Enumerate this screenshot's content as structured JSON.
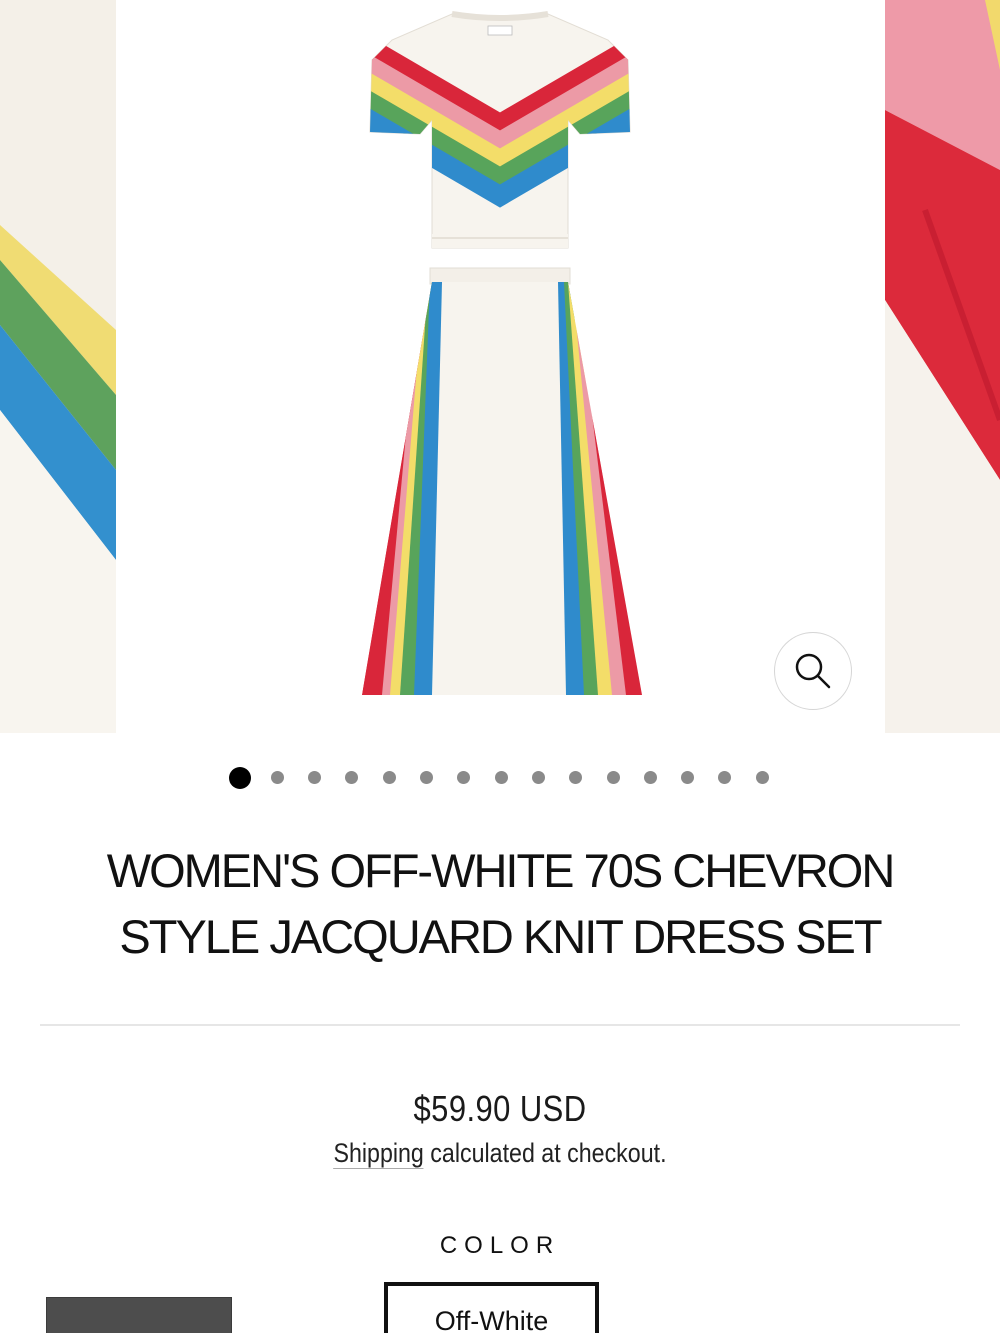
{
  "gallery": {
    "slide_count": 15,
    "active_index": 0,
    "zoom_icon": "search-icon",
    "product_colors": {
      "red": "#d9263a",
      "pink": "#ec9aa6",
      "yellow": "#f3dd69",
      "green": "#58a45b",
      "blue": "#2f8bcc",
      "fabric": "#f7f4ee"
    }
  },
  "product": {
    "title": "WOMEN'S OFF-WHITE 70S CHEVRON STYLE JACQUARD KNIT DRESS SET",
    "price": "$59.90 USD",
    "shipping_link": "Shipping",
    "shipping_rest": " calculated at checkout."
  },
  "options": {
    "color_label": "COLOR",
    "selected_color": "Off-White"
  }
}
